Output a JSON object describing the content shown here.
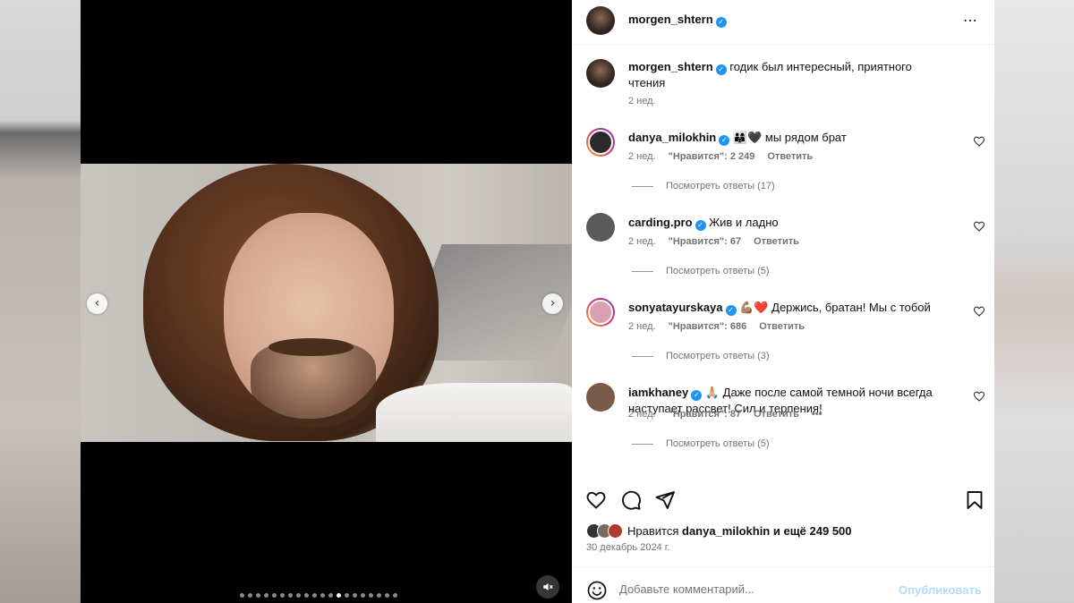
{
  "post": {
    "author": "morgen_shtern",
    "more_icon": "⋯",
    "caption": "годик был интересный, приятного чтения",
    "caption_time": "2 нед."
  },
  "media": {
    "prev_icon": "‹",
    "next_icon": "›",
    "dot_count": 20,
    "active_dot": 12,
    "mute_icon": "speaker-muted-icon"
  },
  "comments": [
    {
      "user": "danya_milokhin",
      "verified": true,
      "text": "мы рядом брат",
      "emoji": "👨‍👩‍👦🖤",
      "time": "2 нед.",
      "likes": "\"Нравится\": 2 249",
      "reply": "Ответить",
      "extra": "",
      "replies": "Посмотреть ответы (17)",
      "ring": true
    },
    {
      "user": "carding.pro",
      "verified": true,
      "text": "Жив и ладно",
      "emoji": "",
      "time": "2 нед.",
      "likes": "\"Нравится\": 67",
      "reply": "Ответить",
      "extra": "",
      "replies": "Посмотреть ответы (5)",
      "ring": false
    },
    {
      "user": "sonyatayurskaya",
      "verified": true,
      "text": "Держись, братан! Мы с тобой",
      "emoji": "💪🏽❤️",
      "time": "2 нед.",
      "likes": "\"Нравится\": 686",
      "reply": "Ответить",
      "extra": "",
      "replies": "Посмотреть ответы (3)",
      "ring": true
    },
    {
      "user": "iamkhaney",
      "verified": true,
      "text": "Даже после самой темной ночи всегда наступает рассвет! Сил и терпения!",
      "emoji": "🙏🏼",
      "time": "2 нед.",
      "likes": "\"Нравится\": 87",
      "reply": "Ответить",
      "extra": "•••",
      "replies": "Посмотреть ответы (5)",
      "ring": false
    }
  ],
  "likes": {
    "prefix": "Нравится",
    "user": "danya_milokhin",
    "suffix": "и ещё 249 500"
  },
  "date": "30 декабрь 2024 г.",
  "comment_bar": {
    "placeholder": "Добавьте комментарий...",
    "publish": "Опубликовать"
  },
  "colors": {
    "verified": "#1e95f2",
    "muted_text": "#737373",
    "publish_disabled": "#b3dbff"
  }
}
